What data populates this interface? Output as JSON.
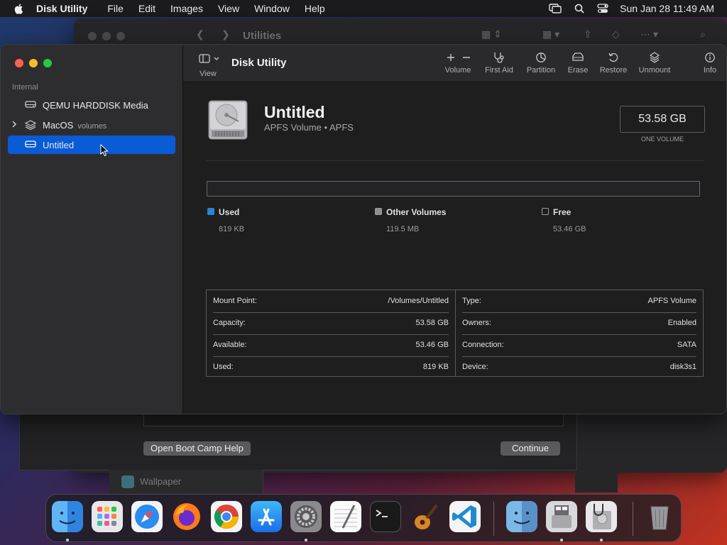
{
  "menubar": {
    "app_name": "Disk Utility",
    "menus": [
      "File",
      "Edit",
      "Images",
      "View",
      "Window",
      "Help"
    ],
    "clock": "Sun Jan 28  11:49 AM"
  },
  "background_window": {
    "title": "Utilities",
    "open_boot_camp_help": "Open Boot Camp Help",
    "continue": "Continue",
    "wallpaper_label": "Wallpaper"
  },
  "sidebar": {
    "section": "Internal",
    "items": [
      {
        "label": "QEMU HARDDISK Media",
        "sub": ""
      },
      {
        "label": "MacOS",
        "sub": "volumes"
      },
      {
        "label": "Untitled",
        "sub": ""
      }
    ],
    "selected_index": 2
  },
  "toolbar": {
    "view_label": "View",
    "title": "Disk Utility",
    "tools": [
      "Volume",
      "First Aid",
      "Partition",
      "Erase",
      "Restore",
      "Unmount",
      "Info"
    ]
  },
  "volume": {
    "name": "Untitled",
    "type": "APFS Volume • APFS",
    "size": "53.58 GB",
    "size_caption": "ONE VOLUME"
  },
  "usage": {
    "used_label": "Used",
    "used_value": "819 KB",
    "other_label": "Other Volumes",
    "other_value": "119.5 MB",
    "free_label": "Free",
    "free_value": "53.46 GB",
    "used_fraction": 0.0
  },
  "info": {
    "left": [
      {
        "key": "Mount Point:",
        "value": "/Volumes/Untitled"
      },
      {
        "key": "Capacity:",
        "value": "53.58 GB"
      },
      {
        "key": "Available:",
        "value": "53.46 GB"
      },
      {
        "key": "Used:",
        "value": "819 KB"
      }
    ],
    "right": [
      {
        "key": "Type:",
        "value": "APFS Volume"
      },
      {
        "key": "Owners:",
        "value": "Enabled"
      },
      {
        "key": "Connection:",
        "value": "SATA"
      },
      {
        "key": "Device:",
        "value": "disk3s1"
      }
    ]
  },
  "colors": {
    "accent": "#0a5bd6",
    "used": "#2a84d6",
    "close": "#ff5f57",
    "minimize": "#febc2e",
    "zoom": "#28c840"
  },
  "dock": {
    "apps": [
      "finder-icon",
      "launchpad-icon",
      "safari-icon",
      "firefox-icon",
      "chrome-icon",
      "app-store-icon",
      "system-preferences-icon",
      "textedit-icon",
      "terminal-icon",
      "garageband-icon",
      "vscode-icon",
      "finder-icon",
      "boot-camp-assistant-icon",
      "disk-utility-icon",
      "trash-icon"
    ]
  }
}
